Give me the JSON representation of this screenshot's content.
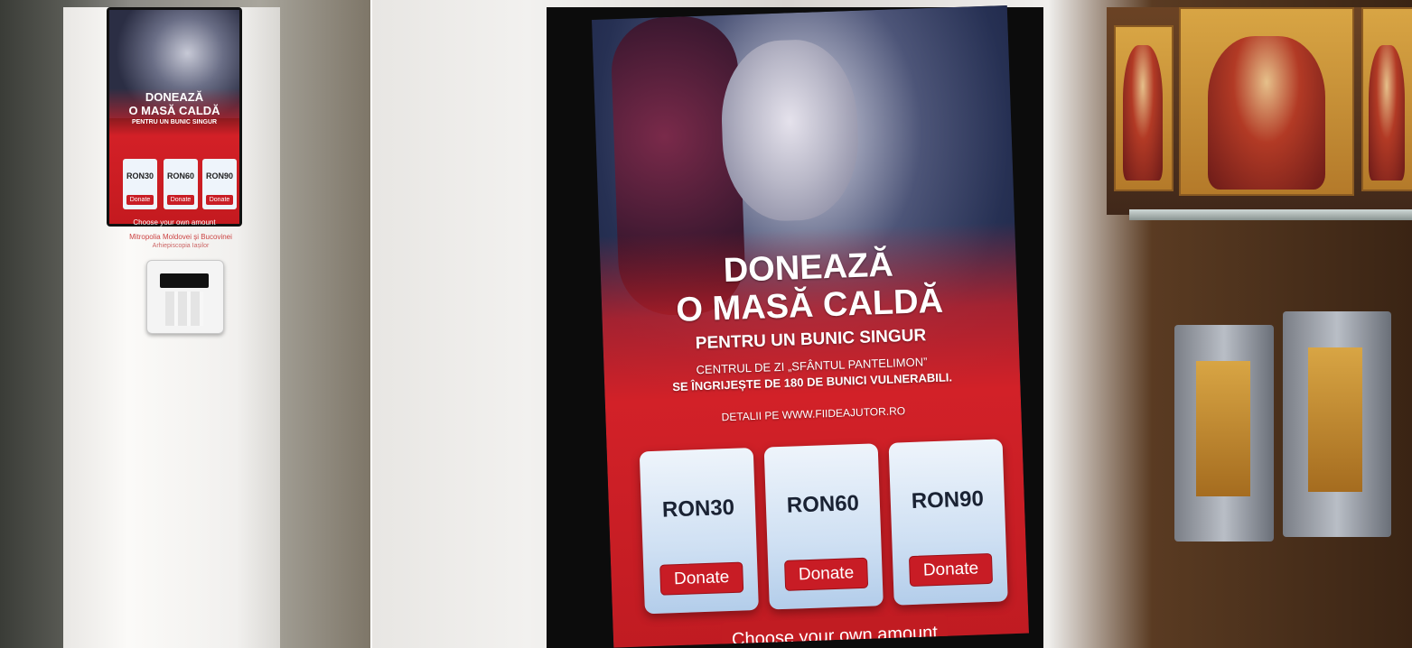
{
  "kiosk_small": {
    "headline_line1": "DONEAZĂ",
    "headline_line2": "O MASĂ CALDĂ",
    "subline": "PENTRU UN BUNIC SINGUR",
    "amounts": [
      "RON30",
      "RON60",
      "RON90"
    ],
    "donate_label": "Donate",
    "choose_label": "Choose your own amount",
    "organization": "Mitropolia Moldovei și Bucovinei",
    "organization_sub": "Arhiepiscopia Iașilor"
  },
  "kiosk_large": {
    "headline_line1": "DONEAZĂ",
    "headline_line2": "O MASĂ CALDĂ",
    "subline": "PENTRU UN BUNIC SINGUR",
    "info_line1": "CENTRUL DE ZI „SFÂNTUL PANTELIMON”",
    "info_line2": "SE ÎNGRIJEȘTE DE 180 DE BUNICI VULNERABILI.",
    "details": "DETALII PE WWW.FIIDEAJUTOR.RO",
    "amount_buttons": [
      {
        "amount": "RON30",
        "action": "Donate"
      },
      {
        "amount": "RON60",
        "action": "Donate"
      },
      {
        "amount": "RON90",
        "action": "Donate"
      }
    ],
    "choose_label": "Choose your own amount"
  },
  "colors": {
    "brand_red": "#d22128",
    "card_blue": "#cfe0f3",
    "title_fragment_blue": "#1a1aa6"
  }
}
